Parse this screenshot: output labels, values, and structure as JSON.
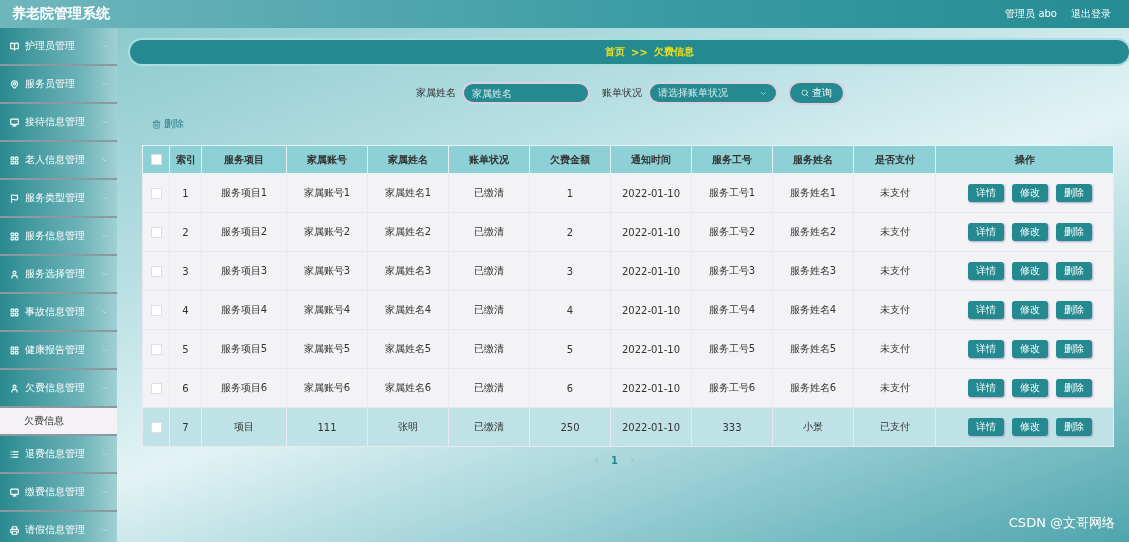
{
  "header": {
    "title": "养老院管理系统",
    "user": "管理员 abo",
    "logout": "退出登录"
  },
  "sidebar": {
    "items": [
      {
        "label": "护理员管理",
        "expanded": false
      },
      {
        "label": "服务员管理",
        "expanded": false
      },
      {
        "label": "接待信息管理",
        "expanded": false
      },
      {
        "label": "老人信息管理",
        "expanded": false
      },
      {
        "label": "服务类型管理",
        "expanded": false
      },
      {
        "label": "服务信息管理",
        "expanded": false
      },
      {
        "label": "服务选择管理",
        "expanded": false
      },
      {
        "label": "事故信息管理",
        "expanded": false
      },
      {
        "label": "健康报告管理",
        "expanded": false
      },
      {
        "label": "欠费信息管理",
        "expanded": true,
        "children": [
          {
            "label": "欠费信息",
            "selected": true
          }
        ]
      },
      {
        "label": "退费信息管理",
        "expanded": false
      },
      {
        "label": "缴费信息管理",
        "expanded": false
      },
      {
        "label": "请假信息管理",
        "expanded": false
      }
    ]
  },
  "breadcrumb": [
    "首页",
    ">>",
    "欠费信息"
  ],
  "search": {
    "fields": [
      {
        "label": "家属姓名",
        "kind": "input",
        "placeholder": "家属姓名"
      },
      {
        "label": "账单状况",
        "kind": "select",
        "placeholder": "请选择账单状况"
      }
    ],
    "button": "查询"
  },
  "toolbar": {
    "delete": "删除"
  },
  "table": {
    "columns": [
      "索引",
      "服务项目",
      "家属账号",
      "家属姓名",
      "账单状况",
      "欠费金额",
      "通知时间",
      "服务工号",
      "服务姓名",
      "是否支付",
      "操作"
    ],
    "header_checked": false,
    "rows": [
      {
        "checked": false,
        "highlighted": false,
        "cells": [
          "1",
          "服务项目1",
          "家属账号1",
          "家属姓名1",
          "已缴清",
          "1",
          "2022-01-10",
          "服务工号1",
          "服务姓名1",
          "未支付"
        ],
        "actions": [
          "详情",
          "修改",
          "删除"
        ]
      },
      {
        "checked": false,
        "highlighted": false,
        "cells": [
          "2",
          "服务项目2",
          "家属账号2",
          "家属姓名2",
          "已缴清",
          "2",
          "2022-01-10",
          "服务工号2",
          "服务姓名2",
          "未支付"
        ],
        "actions": [
          "详情",
          "修改",
          "删除"
        ]
      },
      {
        "checked": false,
        "highlighted": false,
        "cells": [
          "3",
          "服务项目3",
          "家属账号3",
          "家属姓名3",
          "已缴清",
          "3",
          "2022-01-10",
          "服务工号3",
          "服务姓名3",
          "未支付"
        ],
        "actions": [
          "详情",
          "修改",
          "删除"
        ]
      },
      {
        "checked": false,
        "highlighted": false,
        "cells": [
          "4",
          "服务项目4",
          "家属账号4",
          "家属姓名4",
          "已缴清",
          "4",
          "2022-01-10",
          "服务工号4",
          "服务姓名4",
          "未支付"
        ],
        "actions": [
          "详情",
          "修改",
          "删除"
        ]
      },
      {
        "checked": false,
        "highlighted": false,
        "cells": [
          "5",
          "服务项目5",
          "家属账号5",
          "家属姓名5",
          "已缴清",
          "5",
          "2022-01-10",
          "服务工号5",
          "服务姓名5",
          "未支付"
        ],
        "actions": [
          "详情",
          "修改",
          "删除"
        ]
      },
      {
        "checked": false,
        "highlighted": false,
        "cells": [
          "6",
          "服务项目6",
          "家属账号6",
          "家属姓名6",
          "已缴清",
          "6",
          "2022-01-10",
          "服务工号6",
          "服务姓名6",
          "未支付"
        ],
        "actions": [
          "详情",
          "修改",
          "删除"
        ]
      },
      {
        "checked": false,
        "highlighted": true,
        "cells": [
          "7",
          "项目",
          "111",
          "张明",
          "已缴清",
          "250",
          "2022-01-10",
          "333",
          "小景",
          "已支付"
        ],
        "actions": [
          "详情",
          "修改",
          "删除"
        ]
      }
    ]
  },
  "pagination": {
    "pages": [
      {
        "label": "1",
        "selected": true
      }
    ]
  },
  "watermark": "CSDN @文哥网络"
}
